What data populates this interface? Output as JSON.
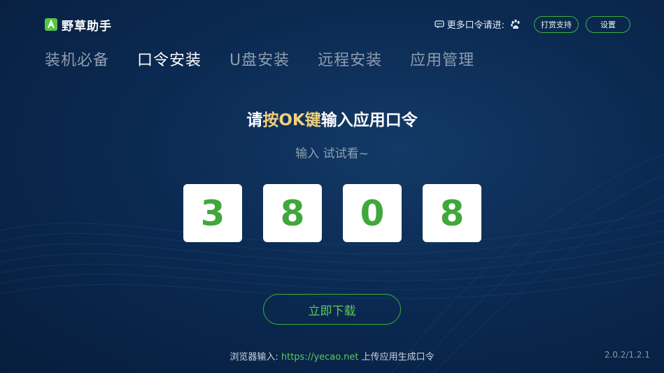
{
  "app": {
    "title": "野草助手"
  },
  "header": {
    "hint": "更多口令请进:",
    "donate_label": "打赏支持",
    "settings_label": "设置"
  },
  "nav": {
    "items": [
      {
        "label": "装机必备"
      },
      {
        "label": "口令安装",
        "active": true
      },
      {
        "label": "U盘安装"
      },
      {
        "label": "远程安装"
      },
      {
        "label": "应用管理"
      }
    ]
  },
  "main": {
    "headline_pre": "请",
    "headline_accent": "按OK键",
    "headline_post": "输入应用口令",
    "subhint": "输入 试试看~",
    "code_digits": [
      "3",
      "8",
      "0",
      "8"
    ],
    "download_label": "立即下载"
  },
  "footer": {
    "prefix": "浏览器输入: ",
    "url": "https://yecao.net",
    "suffix": " 上传应用生成口令",
    "version": "2.0.2/1.2.1"
  },
  "colors": {
    "accent_green": "#3fae3a",
    "highlight_yellow": "#f0cf7e",
    "background": "#0b2a52"
  },
  "icons": {
    "logo": "yecao-logo-icon",
    "chat": "chat-bubble-icon",
    "paw": "baidu-paw-icon"
  }
}
